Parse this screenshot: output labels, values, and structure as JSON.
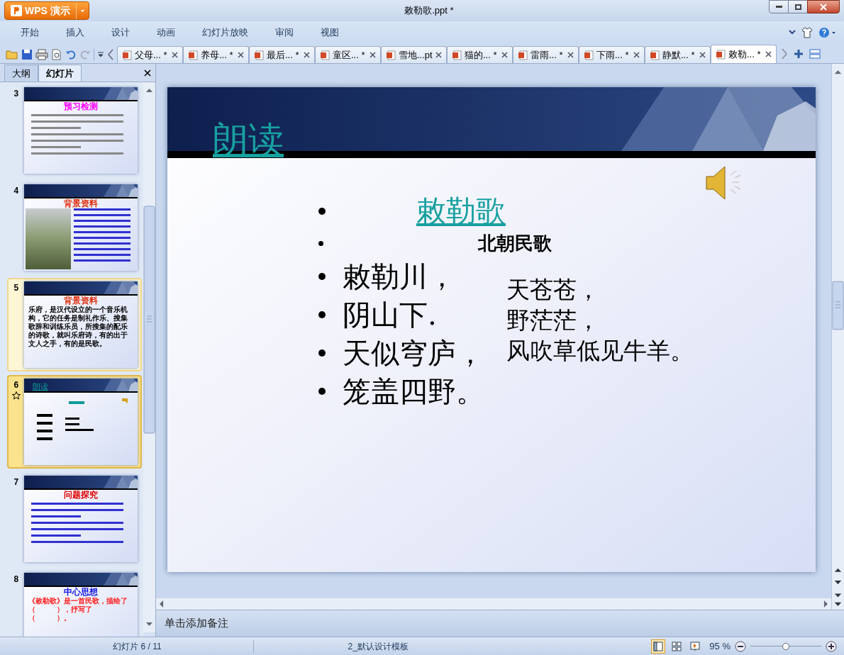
{
  "window": {
    "app_button": "WPS 演示",
    "title": "敕勒歌.ppt *"
  },
  "menu": [
    "开始",
    "插入",
    "设计",
    "动画",
    "幻灯片放映",
    "审阅",
    "视图"
  ],
  "doc_tabs": [
    {
      "label": "父母... *",
      "selected": false
    },
    {
      "label": "养母... *",
      "selected": false
    },
    {
      "label": "最后... *",
      "selected": false
    },
    {
      "label": "童区... *",
      "selected": false
    },
    {
      "label": "雪地...pt",
      "selected": false
    },
    {
      "label": "猫的... *",
      "selected": false
    },
    {
      "label": "雷雨... *",
      "selected": false
    },
    {
      "label": "下雨... *",
      "selected": false
    },
    {
      "label": "静默... *",
      "selected": false
    },
    {
      "label": "敕勒... *",
      "selected": true
    }
  ],
  "panel_tabs": [
    {
      "label": "大纲",
      "selected": false
    },
    {
      "label": "幻灯片",
      "selected": true
    }
  ],
  "thumbnails": [
    {
      "number": "3",
      "kind": "text",
      "title": "预习检测",
      "color": "#ff00ff",
      "selected": false,
      "highlighted": false,
      "animated": false
    },
    {
      "number": "4",
      "kind": "photo",
      "title": "背景资料",
      "color": "#e03010",
      "selected": false,
      "highlighted": false,
      "animated": false
    },
    {
      "number": "5",
      "kind": "body",
      "title": "背景资料",
      "color": "#e03010",
      "body": {
        "text": "乐府，是汉代设立的一个音乐机构，它的任务是制礼作乐、搜集歌辞和训练乐员，所搜集的配乐的诗歌，就叫乐府诗，有的出于文人之手，有的是民歌。",
        "color": "#000000"
      },
      "selected": false,
      "highlighted": true,
      "animated": false
    },
    {
      "number": "6",
      "kind": "mini",
      "title": "朗读",
      "color": "#109a9a",
      "selected": true,
      "highlighted": false,
      "animated": true
    },
    {
      "number": "7",
      "kind": "text",
      "title": "问题探究",
      "color": "#e00000",
      "selected": false,
      "highlighted": false,
      "animated": false
    },
    {
      "number": "8",
      "kind": "body",
      "title": "中心思想",
      "color": "#1010e0",
      "body": {
        "text": "《敕勒歌》是一首民歌，描绘了（　　　），抒写了（　　　）。",
        "color": "#ff2020"
      },
      "selected": false,
      "highlighted": false,
      "animated": false
    }
  ],
  "slide": {
    "title": "朗读",
    "bullets": [
      {
        "kind": "heading",
        "text": "敕勒歌"
      },
      {
        "kind": "subheading",
        "text": "北朝民歌"
      }
    ],
    "lines": [
      "敕勒川，",
      "阴山下.",
      "天似穹庐，",
      "笼盖四野。"
    ],
    "right_lines": [
      "天苍苍，",
      "野茫茫，",
      "风吹草低见牛羊。"
    ]
  },
  "notes": {
    "placeholder": "单击添加备注"
  },
  "status_bar": {
    "slide_counter": "幻灯片 6 / 11",
    "template": "2_默认设计模板",
    "views": [
      {
        "kind": "normal",
        "selected": true
      },
      {
        "kind": "sorter",
        "selected": false
      },
      {
        "kind": "show",
        "selected": false
      }
    ],
    "zoom": "95 %",
    "zoom_slider": {
      "level": 0.5
    }
  }
}
